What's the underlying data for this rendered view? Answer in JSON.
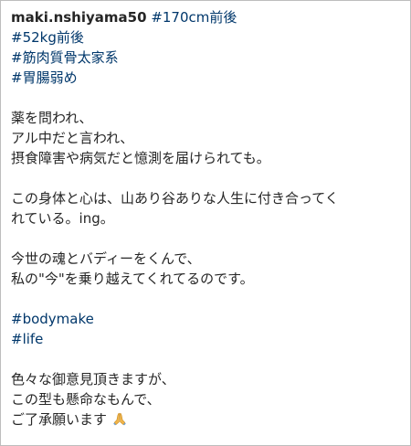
{
  "post": {
    "username": "maki.nshiyama50",
    "hashtags_top": [
      "#170cm前後",
      "#52kg前後",
      "#筋肉質骨太家系",
      "#胃腸弱め"
    ],
    "paragraph1": [
      "薬を問われ、",
      "アル中だと言われ、",
      "摂食障害や病気だと憶測を届けられても。"
    ],
    "paragraph2": [
      "この身体と心は、山あり谷ありな人生に付き合ってく",
      "れている。ing。"
    ],
    "paragraph3": [
      "今世の魂とバディーをくんで、",
      "私の\"今\"を乗り越えてくれてるのです。"
    ],
    "hashtags_bottom": [
      "#bodymake",
      "#life"
    ],
    "paragraph4": [
      "色々な御意見頂きますが、",
      "この型も懸命なもんで、",
      "ご了承願います"
    ],
    "emoji": "folded-hands-icon"
  },
  "colors": {
    "hashtag": "#00376b",
    "text": "#262626",
    "border": "#bdbdbd"
  }
}
